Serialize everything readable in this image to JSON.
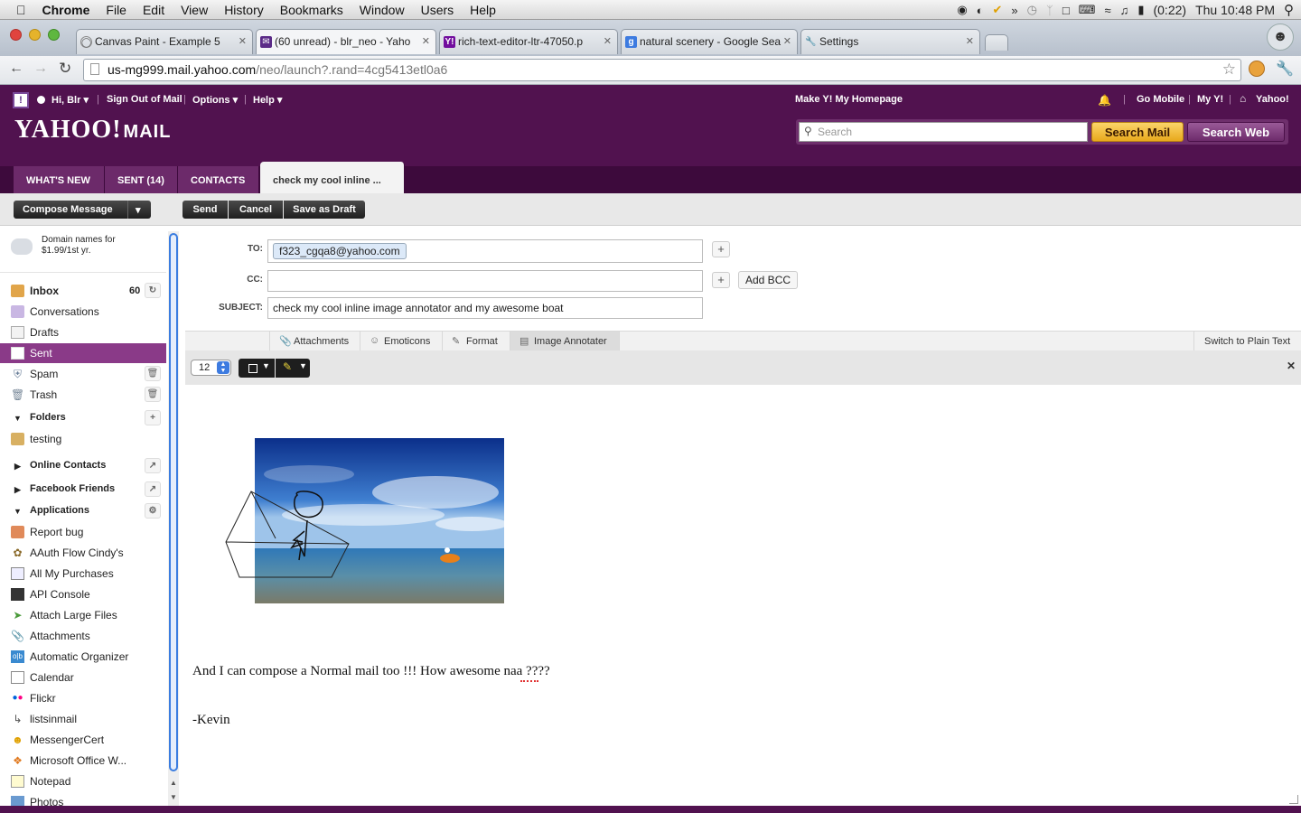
{
  "menubar": {
    "app": "Chrome",
    "items": [
      "File",
      "Edit",
      "View",
      "History",
      "Bookmarks",
      "Window",
      "Users",
      "Help"
    ],
    "battery": "(0:22)",
    "clock": "Thu 10:48 PM"
  },
  "tabs": [
    {
      "title": "Canvas Paint - Example 5"
    },
    {
      "title": "(60 unread) - blr_neo - Yaho"
    },
    {
      "title": "rich-text-editor-ltr-47050.p"
    },
    {
      "title": "natural scenery - Google Sea"
    },
    {
      "title": "Settings"
    }
  ],
  "address": {
    "host": "us-mg999.mail.yahoo.com",
    "path": "/neo/launch?.rand=4cg5413etl0a6"
  },
  "yahoo": {
    "greeting": "Hi, Blr",
    "signout": "Sign Out of Mail",
    "options": "Options",
    "help": "Help",
    "homepage": "Make Y! My Homepage",
    "go_mobile": "Go Mobile",
    "my_y": "My Y!",
    "yahoo_link": "Yahoo!",
    "logo_a": "YAHOO!",
    "logo_b": "MAIL",
    "search_placeholder": "Search",
    "search_mail": "Search Mail",
    "search_web": "Search Web"
  },
  "nav_tabs": [
    "WHAT'S NEW",
    "SENT (14)",
    "CONTACTS",
    "check my cool inline ..."
  ],
  "actions": {
    "compose": "Compose Message",
    "send": "Send",
    "cancel": "Cancel",
    "save_draft": "Save as Draft"
  },
  "sidebar": {
    "ad_text": "Domain names for $1.99/1st yr.",
    "inbox": "Inbox",
    "inbox_count": "60",
    "conversations": "Conversations",
    "drafts": "Drafts",
    "sent": "Sent",
    "spam": "Spam",
    "trash": "Trash",
    "folders": "Folders",
    "testing": "testing",
    "online_contacts": "Online Contacts",
    "facebook_friends": "Facebook Friends",
    "applications": "Applications",
    "apps": [
      "Report bug",
      "AAuth Flow Cindy's",
      "All My Purchases",
      "API Console",
      "Attach Large Files",
      "Attachments",
      "Automatic Organizer",
      "Calendar",
      "Flickr",
      "listsinmail",
      "MessengerCert",
      "Microsoft Office W...",
      "Notepad",
      "Photos"
    ]
  },
  "compose": {
    "to_label": "TO:",
    "to_value": "f323_cgqa8@yahoo.com",
    "cc_label": "CC:",
    "add_bcc": "Add BCC",
    "subject_label": "SUBJECT:",
    "subject_value": "check my cool inline image annotator  and my awesome boat",
    "tool_tabs": [
      "Attachments",
      "Emoticons",
      "Format",
      "Image Annotater"
    ],
    "plain_text": "Switch to Plain Text",
    "font_size": "12",
    "body_line1": "And I can compose a Normal mail too !!! How awesome naa ????",
    "body_line2": "-Kevin"
  }
}
